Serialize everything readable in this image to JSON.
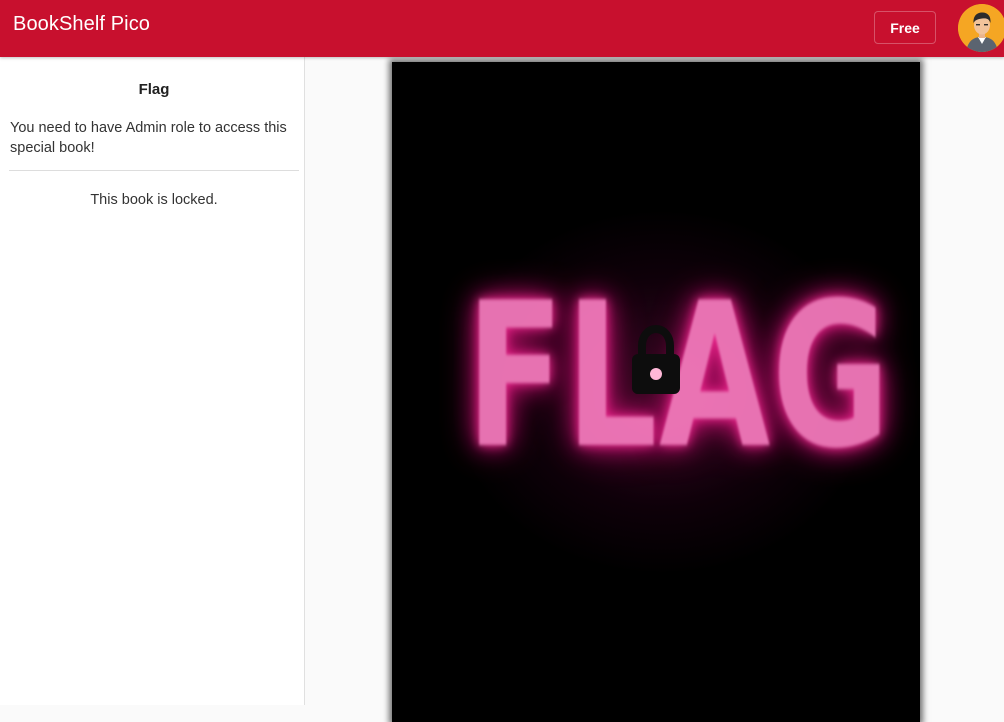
{
  "app": {
    "title": "BookShelf Pico",
    "plan_label": "Free",
    "avatar_icon": "user-avatar-icon",
    "brand_color": "#c8102e"
  },
  "book": {
    "title": "Flag",
    "description": "You need to have Admin role to access this special book!",
    "status": "This book is locked.",
    "cover_text": "FLAG",
    "cover_icon": "lock-icon"
  }
}
